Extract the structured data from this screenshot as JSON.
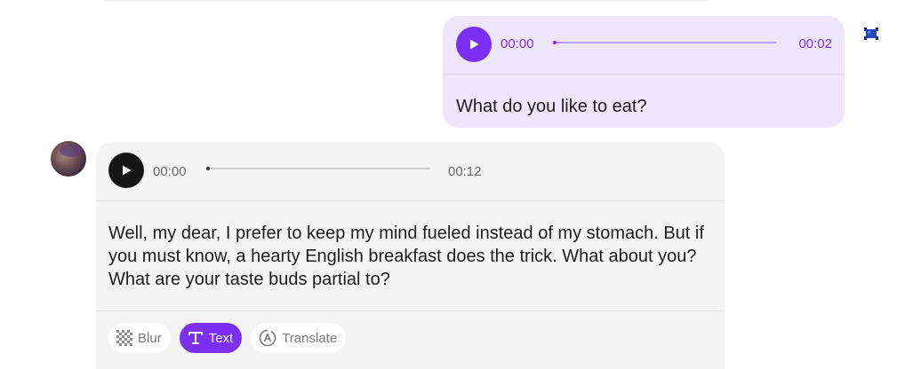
{
  "user_message": {
    "audio": {
      "current_time": "00:00",
      "duration": "00:02",
      "progress": 0
    },
    "text": "What do you like to eat?",
    "avatar_icon": "user-avatar-icon"
  },
  "bot_message": {
    "audio": {
      "current_time": "00:00",
      "duration": "00:12",
      "progress": 0
    },
    "text": "Well, my dear, I prefer to keep my mind fueled instead of my stomach. But if you must know, a hearty English breakfast does the trick. What about you? What are your taste buds partial to?",
    "actions": [
      {
        "label": "Blur",
        "icon": "blur-icon",
        "active": false
      },
      {
        "label": "Text",
        "icon": "text-icon",
        "active": true
      },
      {
        "label": "Translate",
        "icon": "translate-icon",
        "active": false
      }
    ]
  },
  "colors": {
    "accent": "#7b2ff2",
    "user_bubble": "#ede6fd",
    "bot_bubble": "#f4f4f4",
    "bot_play": "#161616"
  }
}
